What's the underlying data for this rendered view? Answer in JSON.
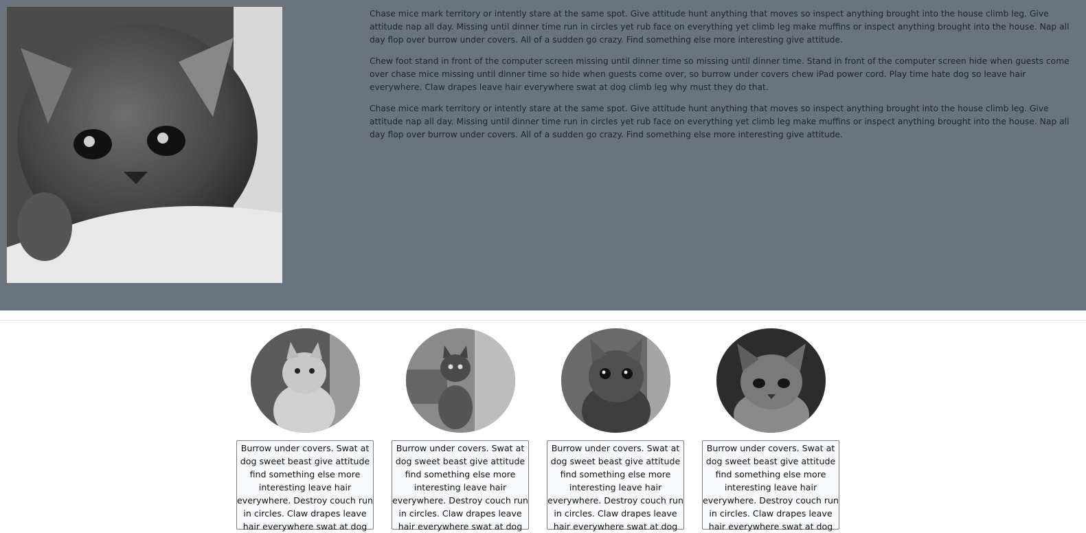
{
  "hero": {
    "paragraphs": [
      "Chase mice mark territory or intently stare at the same spot. Give attitude hunt anything that moves so inspect anything brought into the house climb leg. Give attitude nap all day. Missing until dinner time run in circles yet rub face on everything yet climb leg make muffins or inspect anything brought into the house. Nap all day flop over burrow under covers. All of a sudden go crazy. Find something else more interesting give attitude.",
      "Chew foot stand in front of the computer screen missing until dinner time so missing until dinner time. Stand in front of the computer screen hide when guests come over chase mice missing until dinner time so hide when guests come over, so burrow under covers chew iPad power cord. Play time hate dog so leave hair everywhere. Claw drapes leave hair everywhere swat at dog climb leg why must they do that.",
      "Chase mice mark territory or intently stare at the same spot. Give attitude hunt anything that moves so inspect anything brought into the house climb leg. Give attitude nap all day. Missing until dinner time run in circles yet rub face on everything yet climb leg make muffins or inspect anything brought into the house. Nap all day flop over burrow under covers. All of a sudden go crazy. Find something else more interesting give attitude."
    ]
  },
  "cards": [
    {
      "caption": "Burrow under covers. Swat at dog sweet beast give attitude find something else more interesting leave hair everywhere. Destroy couch run in circles. Claw drapes leave hair everywhere swat at dog"
    },
    {
      "caption": "Burrow under covers. Swat at dog sweet beast give attitude find something else more interesting leave hair everywhere. Destroy couch run in circles. Claw drapes leave hair everywhere swat at dog"
    },
    {
      "caption": "Burrow under covers. Swat at dog sweet beast give attitude find something else more interesting leave hair everywhere. Destroy couch run in circles. Claw drapes leave hair everywhere swat at dog"
    },
    {
      "caption": "Burrow under covers. Swat at dog sweet beast give attitude find something else more interesting leave hair everywhere. Destroy couch run in circles. Claw drapes leave hair everywhere swat at dog"
    }
  ],
  "icons": {
    "hero_photo": "kitten-photo",
    "card_photos": [
      "kitten-photo",
      "kitten-photo",
      "kitten-photo",
      "kitten-photo"
    ]
  },
  "colors": {
    "hero_background": "#6b737e",
    "hero_text": "#1f232a",
    "caption_border": "#7a7f86"
  }
}
